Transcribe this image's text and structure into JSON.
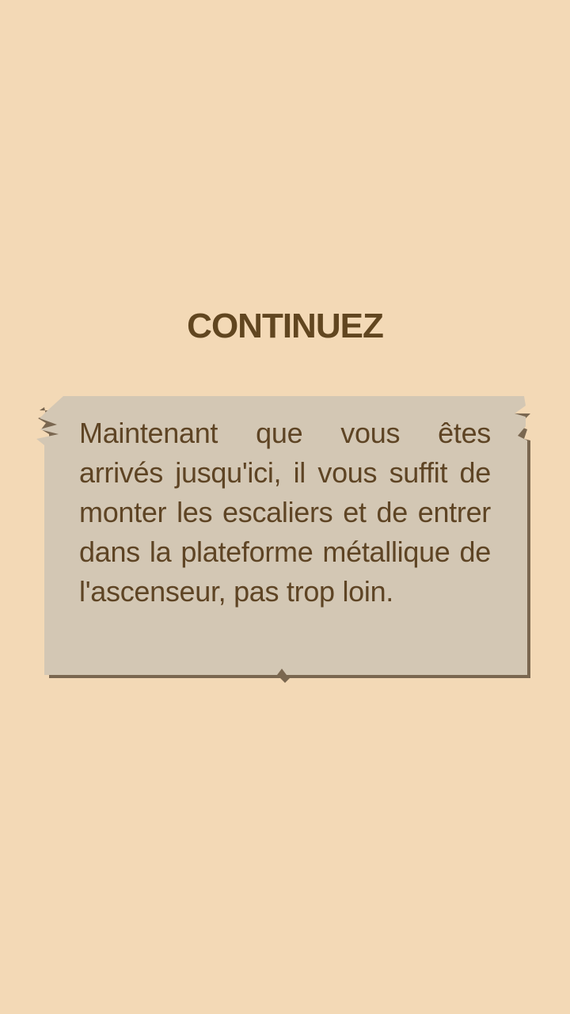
{
  "page": {
    "title": "CONTINUEZ",
    "message": "Maintenant que vous êtes arrivés jusqu'ici, il vous suffit de monter les escaliers et de entrer dans la plateforme métallique de l'ascenseur, pas trop loin."
  },
  "colors": {
    "background": "#f3d9b6",
    "title": "#614620",
    "note_paper": "#d3c7b4",
    "note_shadow": "#6d5a45",
    "note_text": "#5e4424"
  }
}
